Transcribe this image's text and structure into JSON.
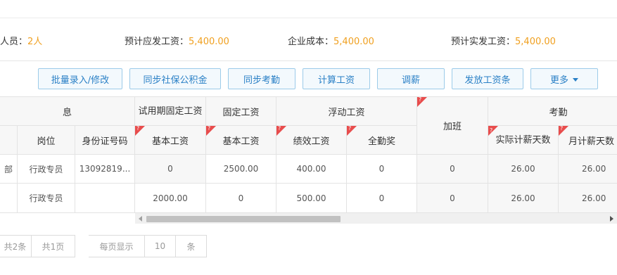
{
  "summary": {
    "people_label": "人员：",
    "people_value": "2人",
    "payable_label": "预计应发工资：",
    "payable_value": "5,400.00",
    "cost_label": "企业成本：",
    "cost_value": "5,400.00",
    "actual_label": "预计实发工资：",
    "actual_value": "5,400.00"
  },
  "toolbar": {
    "batch": "批量录入/修改",
    "sync_social": "同步社保公积金",
    "sync_attendance": "同步考勤",
    "calc": "计算工资",
    "adjust": "调薪",
    "payslip": "发放工资条",
    "more": "更多"
  },
  "table": {
    "groups": {
      "info_tail": "息",
      "probation_fixed": "试用期固定工资",
      "fixed": "固定工资",
      "floating": "浮动工资",
      "overtime": "加班",
      "attendance": "考勤"
    },
    "cols": {
      "position": "岗位",
      "id_number": "身份证号码",
      "probation_base": "基本工资",
      "fixed_base": "基本工资",
      "performance": "绩效工资",
      "full_attendance": "全勤奖",
      "actual_days": "实际计薪天数",
      "monthly_days": "月计薪天数"
    },
    "rows": [
      {
        "dept": "部",
        "position": "行政专员",
        "id_number": "13092819...",
        "probation_base": "0",
        "fixed_base": "2500.00",
        "performance": "400.00",
        "full_attendance": "0",
        "overtime": "0",
        "actual_days": "26.00",
        "monthly_days": "26.00"
      },
      {
        "dept": "",
        "position": "行政专员",
        "id_number": "",
        "probation_base": "2000.00",
        "fixed_base": "0",
        "performance": "500.00",
        "full_attendance": "0",
        "overtime": "0",
        "actual_days": "26.00",
        "monthly_days": "26.00"
      }
    ]
  },
  "pager": {
    "total_items": "共2条",
    "total_pages": "共1页",
    "per_page_label": "每页显示",
    "per_page_value": "10",
    "unit": "条"
  },
  "colors": {
    "accent": "#2a80c6",
    "highlight": "#f0a020",
    "flag": "#e84c4c"
  }
}
